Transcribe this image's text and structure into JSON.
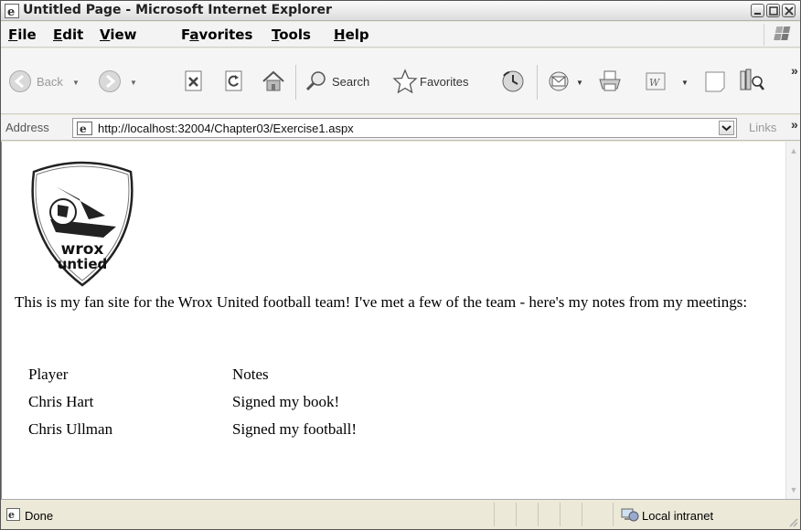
{
  "window": {
    "title": "Untitled Page - Microsoft Internet Explorer"
  },
  "menu": [
    {
      "pre": "",
      "u": "F",
      "post": "ile"
    },
    {
      "pre": "",
      "u": "E",
      "post": "dit"
    },
    {
      "pre": "",
      "u": "V",
      "post": "iew"
    },
    {
      "pre": "F",
      "u": "a",
      "post": "vorites"
    },
    {
      "pre": "",
      "u": "T",
      "post": "ools"
    },
    {
      "pre": "",
      "u": "H",
      "post": "elp"
    }
  ],
  "toolbar": {
    "back_label": "Back",
    "search_label": "Search",
    "favorites_label": "Favorites"
  },
  "address": {
    "label": "Address",
    "url": "http://localhost:32004/Chapter03/Exercise1.aspx",
    "links_label": "Links"
  },
  "page": {
    "logo_line1": "wrox",
    "logo_line2": "untied",
    "intro": "This is my fan site for the Wrox United football team! I've met a few of the team - here's my notes from my meetings:",
    "table": {
      "headers": [
        "Player",
        "Notes"
      ],
      "rows": [
        [
          "Chris Hart",
          "Signed my book!"
        ],
        [
          "Chris Ullman",
          "Signed my football!"
        ]
      ]
    }
  },
  "status": {
    "text": "Done",
    "zone": "Local intranet"
  },
  "colors": {
    "accent_green": "#2e8b2e",
    "accent_blue": "#2a6ac0"
  }
}
